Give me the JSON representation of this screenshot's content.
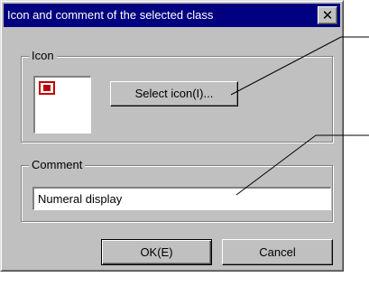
{
  "dialog": {
    "title": "Icon and comment of the selected class",
    "close_label": "✕"
  },
  "icon_group": {
    "label": "Icon",
    "select_button_label": "Select icon(I)..."
  },
  "comment_group": {
    "label": "Comment",
    "comment_value": "Numeral display"
  },
  "buttons": {
    "ok_label": "OK(E)",
    "cancel_label": "Cancel"
  },
  "colors": {
    "titlebar": "#000080",
    "dialog_face": "#c0c0c0",
    "icon_accent": "#c00000"
  },
  "icons": {
    "close": "close-icon",
    "class_icon": "class-icon"
  }
}
